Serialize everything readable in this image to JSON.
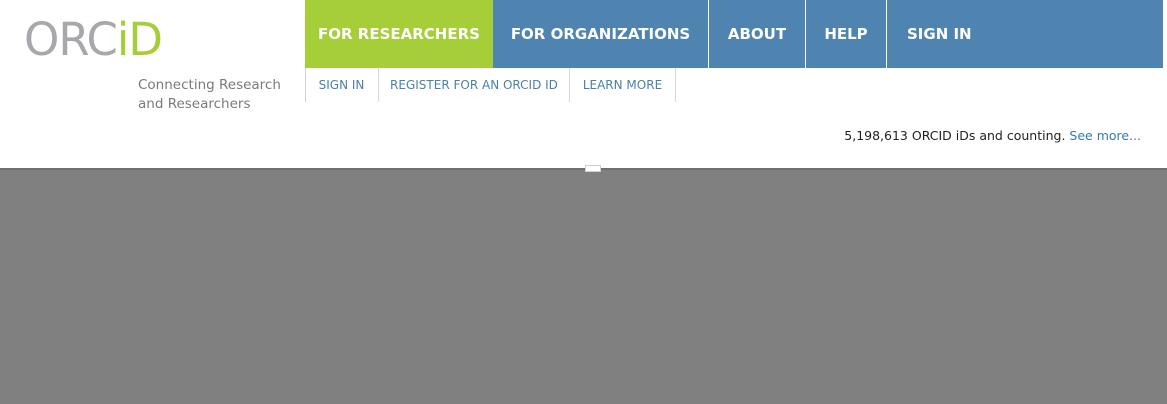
{
  "logo": {
    "text_orc": "ORC",
    "text_id": "iD",
    "tagline": "Connecting Research and Researchers"
  },
  "main_nav": [
    {
      "label": "FOR RESEARCHERS",
      "color": "#a6ce39",
      "active": true
    },
    {
      "label": "FOR ORGANIZATIONS",
      "color": "#4f84b0",
      "active": false
    },
    {
      "label": "ABOUT",
      "color": "#4f84b0",
      "active": false
    },
    {
      "label": "HELP",
      "color": "#4f84b0",
      "active": false
    },
    {
      "label": "SIGN IN",
      "color": "#4f84b0",
      "active": false
    }
  ],
  "sub_nav": [
    {
      "label": "SIGN IN"
    },
    {
      "label": "REGISTER FOR AN ORCID ID"
    },
    {
      "label": "LEARN MORE"
    }
  ],
  "counter": {
    "text": "5,198,613 ORCID iDs and counting.",
    "link": "See more..."
  },
  "colors": {
    "overlay": "#808080",
    "accent_green": "#a6ce39",
    "nav_blue": "#4f84b0",
    "link_blue": "#3b77b0"
  }
}
